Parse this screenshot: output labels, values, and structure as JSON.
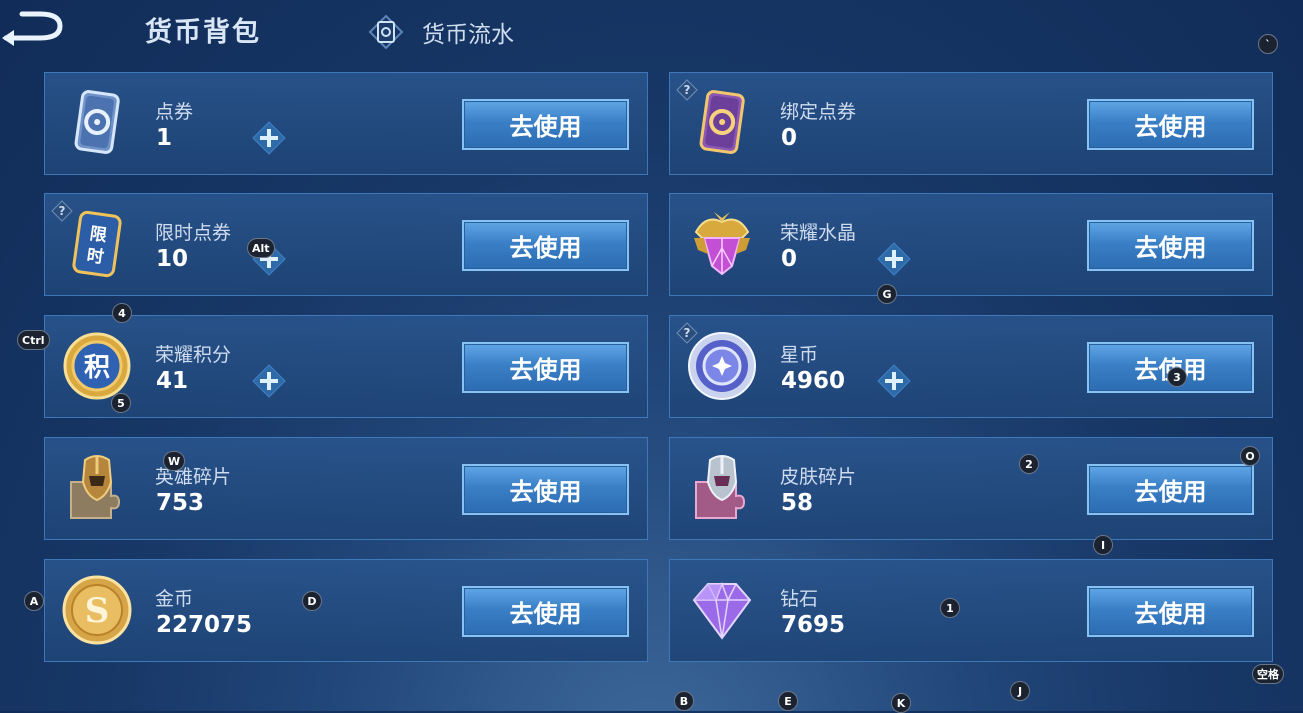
{
  "header": {
    "title": "货币背包",
    "ledger_tab_label": "货币流水"
  },
  "currencies": [
    {
      "name": "点券",
      "amount": "1",
      "use_label": "去使用"
    },
    {
      "name": "绑定点券",
      "amount": "0",
      "use_label": "去使用"
    },
    {
      "name": "限时点券",
      "amount": "10",
      "use_label": "去使用"
    },
    {
      "name": "荣耀水晶",
      "amount": "0",
      "use_label": "去使用"
    },
    {
      "name": "荣耀积分",
      "amount": "41",
      "use_label": "去使用"
    },
    {
      "name": "星币",
      "amount": "4960",
      "use_label": "去使用"
    },
    {
      "name": "英雄碎片",
      "amount": "753",
      "use_label": "去使用"
    },
    {
      "name": "皮肤碎片",
      "amount": "58",
      "use_label": "去使用"
    },
    {
      "name": "金币",
      "amount": "227075",
      "use_label": "去使用"
    },
    {
      "name": "钻石",
      "amount": "7695",
      "use_label": "去使用"
    }
  ],
  "icon_glyphs": {
    "limited_ticket": "限时",
    "glory_points": "积",
    "gold_coin": "S"
  },
  "key_hints": {
    "backtick": "`",
    "ctrl": "Ctrl",
    "alt": "Alt",
    "k4": "4",
    "k5": "5",
    "g": "G",
    "k3": "3",
    "w": "W",
    "k2": "2",
    "o": "O",
    "i": "I",
    "a": "A",
    "d": "D",
    "k1": "1",
    "space": "空格",
    "b": "B",
    "e": "E",
    "k": "K",
    "j": "J"
  },
  "colors": {
    "background": "#173766",
    "card": "#28548c",
    "button": "#3a7fc6",
    "button_border": "#86c2f3"
  }
}
